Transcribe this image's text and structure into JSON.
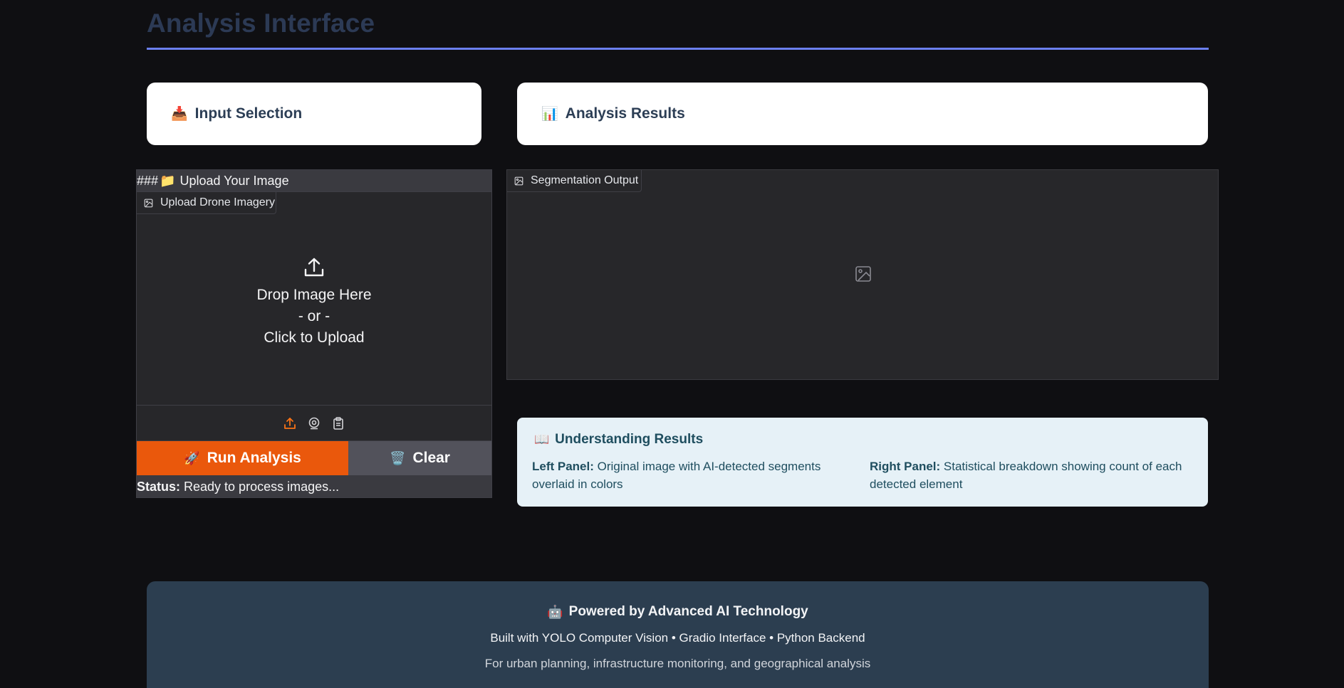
{
  "page": {
    "title": "Analysis Interface"
  },
  "input_card": {
    "emoji": "📥",
    "title": "Input Selection"
  },
  "results_card": {
    "emoji": "📊",
    "title": "Analysis Results"
  },
  "upload": {
    "header_prefix": "###",
    "header_emoji": "📁",
    "header_text": "Upload Your Image",
    "image_label": "Upload Drone Imagery",
    "drop_line1": "Drop Image Here",
    "drop_line2": "- or -",
    "drop_line3": "Click to Upload",
    "source_icons": [
      "upload-icon",
      "webcam-icon",
      "clipboard-icon"
    ]
  },
  "actions": {
    "run_emoji": "🚀",
    "run_label": "Run Analysis",
    "clear_emoji": "🗑️",
    "clear_label": "Clear",
    "run_color": "#ea580c",
    "clear_color": "#52525b"
  },
  "status": {
    "label": "Status:",
    "text": "Ready to process images..."
  },
  "output": {
    "label": "Segmentation Output"
  },
  "understanding": {
    "emoji": "📖",
    "title": "Understanding Results",
    "left_label": "Left Panel:",
    "left_text": "Original image with AI-detected segments overlaid in colors",
    "right_label": "Right Panel:",
    "right_text": "Statistical breakdown showing count of each detected element"
  },
  "footer": {
    "emoji": "🤖",
    "title": "Powered by Advanced AI Technology",
    "line1": "Built with YOLO Computer Vision • Gradio Interface • Python Backend",
    "line2": "For urban planning, infrastructure monitoring, and geographical analysis"
  },
  "colors": {
    "accent": "#6b7ff0",
    "primary_button": "#ea580c",
    "background": "#0f0f12"
  }
}
